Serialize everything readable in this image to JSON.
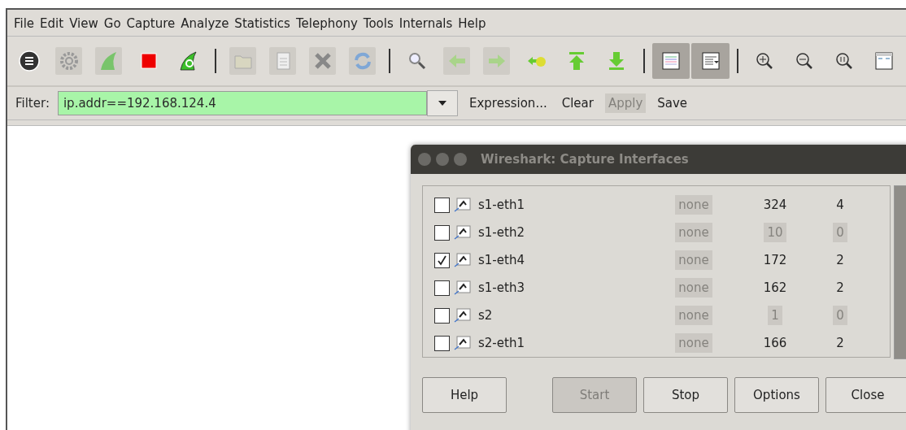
{
  "menu": [
    "File",
    "Edit",
    "View",
    "Go",
    "Capture",
    "Analyze",
    "Statistics",
    "Telephony",
    "Tools",
    "Internals",
    "Help"
  ],
  "toolbar": [
    {
      "kind": "button",
      "disabled": false,
      "pressed": false
    },
    {
      "kind": "button",
      "disabled": true,
      "pressed": false
    },
    {
      "kind": "button",
      "disabled": true,
      "pressed": false
    },
    {
      "kind": "button",
      "disabled": false,
      "pressed": false
    },
    {
      "kind": "button",
      "disabled": false,
      "pressed": false
    },
    {
      "kind": "separator"
    },
    {
      "kind": "button",
      "disabled": true,
      "pressed": false
    },
    {
      "kind": "button",
      "disabled": true,
      "pressed": false
    },
    {
      "kind": "button",
      "disabled": true,
      "pressed": false
    },
    {
      "kind": "button",
      "disabled": true,
      "pressed": false
    },
    {
      "kind": "separator"
    },
    {
      "kind": "button",
      "disabled": false,
      "pressed": false
    },
    {
      "kind": "button",
      "disabled": true,
      "pressed": false
    },
    {
      "kind": "button",
      "disabled": true,
      "pressed": false
    },
    {
      "kind": "button",
      "disabled": false,
      "pressed": false
    },
    {
      "kind": "button",
      "disabled": false,
      "pressed": false
    },
    {
      "kind": "button",
      "disabled": false,
      "pressed": false
    },
    {
      "kind": "separator"
    },
    {
      "kind": "button",
      "disabled": false,
      "pressed": true
    },
    {
      "kind": "button",
      "disabled": false,
      "pressed": true
    },
    {
      "kind": "separator"
    },
    {
      "kind": "button",
      "disabled": false,
      "pressed": false
    },
    {
      "kind": "button",
      "disabled": false,
      "pressed": false
    },
    {
      "kind": "button",
      "disabled": false,
      "pressed": false
    },
    {
      "kind": "button",
      "disabled": false,
      "pressed": false
    }
  ],
  "filter": {
    "label": "Filter:",
    "value": "ip.addr==192.168.124.4",
    "actions": [
      {
        "label": "Expression...",
        "disabled": false
      },
      {
        "label": "Clear",
        "disabled": false
      },
      {
        "label": "Apply",
        "disabled": true
      },
      {
        "label": "Save",
        "disabled": false
      }
    ]
  },
  "dialog": {
    "title": "Wireshark: Capture Interfaces",
    "rows": [
      {
        "name": "s1-eth1",
        "checked": false,
        "cells": [
          {
            "text": "none",
            "dimmed": true
          },
          {
            "text": "324",
            "dimmed": false
          },
          {
            "text": "4",
            "dimmed": false
          }
        ]
      },
      {
        "name": "s1-eth2",
        "checked": false,
        "cells": [
          {
            "text": "none",
            "dimmed": true
          },
          {
            "text": "10",
            "dimmed": true
          },
          {
            "text": "0",
            "dimmed": true
          }
        ]
      },
      {
        "name": "s1-eth4",
        "checked": true,
        "cells": [
          {
            "text": "none",
            "dimmed": true
          },
          {
            "text": "172",
            "dimmed": false
          },
          {
            "text": "2",
            "dimmed": false
          }
        ]
      },
      {
        "name": "s1-eth3",
        "checked": false,
        "cells": [
          {
            "text": "none",
            "dimmed": true
          },
          {
            "text": "162",
            "dimmed": false
          },
          {
            "text": "2",
            "dimmed": false
          }
        ]
      },
      {
        "name": "s2",
        "checked": false,
        "cells": [
          {
            "text": "none",
            "dimmed": true
          },
          {
            "text": "1",
            "dimmed": true
          },
          {
            "text": "0",
            "dimmed": true
          }
        ]
      },
      {
        "name": "s2-eth1",
        "checked": false,
        "cells": [
          {
            "text": "none",
            "dimmed": true
          },
          {
            "text": "166",
            "dimmed": false
          },
          {
            "text": "2",
            "dimmed": false
          }
        ]
      }
    ],
    "buttons": [
      {
        "label": "Help",
        "disabled": false
      },
      {
        "label": "Start",
        "disabled": true
      },
      {
        "label": "Stop",
        "disabled": false
      },
      {
        "label": "Options",
        "disabled": false
      },
      {
        "label": "Close",
        "disabled": false
      }
    ]
  }
}
